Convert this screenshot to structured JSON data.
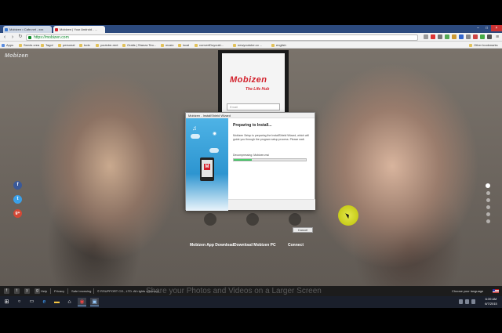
{
  "browser": {
    "tabs": [
      {
        "label": "Mobizen • Cafe.net - xxx",
        "color": "#3a7bd5"
      },
      {
        "label": "Mobizen | Your Android - ...",
        "color": "#d21f2a"
      }
    ],
    "url": "https://mobizen.com",
    "bookmarks": [
      "Apps",
      "Seeds crea",
      "Tagol",
      "personal",
      "todo",
      "youtube-rent",
      "Gratis | Stanza Teo...",
      "music",
      "local",
      "convertDoyouki...",
      "newyoutube.co ...",
      "english",
      "Other bookmarks"
    ]
  },
  "page": {
    "logo_text": "Mobizen",
    "phone": {
      "brand": "Mobizen",
      "tagline": "The Life Hub",
      "email_placeholder": "Email"
    },
    "social": [
      {
        "name": "facebook",
        "glyph": "f",
        "color": "#3b5998"
      },
      {
        "name": "twitter",
        "glyph": "t",
        "color": "#3aa0e8"
      },
      {
        "name": "google-plus",
        "glyph": "g+",
        "color": "#d34836"
      }
    ],
    "actions": [
      "Mobizen App Download",
      "Download Mobizen PC",
      "Connect"
    ],
    "slide_count": 6,
    "active_slide": 1
  },
  "installer": {
    "title": "Mobizen - InstallShield Wizard",
    "heading": "Preparing to Install...",
    "body": "Mobizen Setup is preparing the InstallShield Wizard, which will guide you through the program setup process. Please wait.",
    "status": "Decompressing: Mobizen.msi",
    "progress": 0.25,
    "cancel_label": "Cancel"
  },
  "footer": {
    "social": [
      "f",
      "t",
      "y",
      "g"
    ],
    "links": [
      "Help",
      "Privacy",
      "Safe browsing",
      "© RSUPPORT CO., LTD. All rights reserved"
    ],
    "tagline": "Share your Photos and Videos on a Larger Screen",
    "language_label": "Choose your language"
  },
  "taskbar": {
    "time": "6:39 AM",
    "date": "6/7/2015"
  }
}
